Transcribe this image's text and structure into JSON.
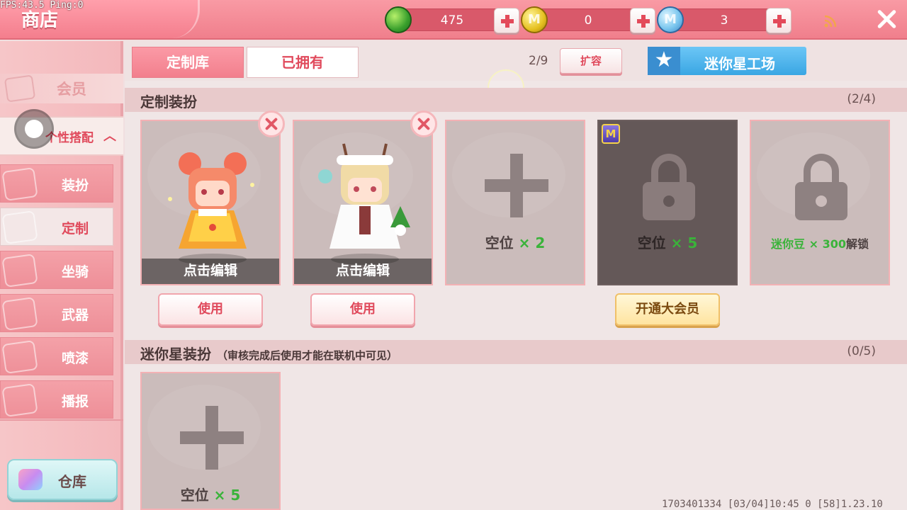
{
  "debug": {
    "fps_text": "FPS:43.5  Ping:0"
  },
  "header": {
    "title": "商店",
    "currencies": [
      {
        "icon": "green-gem-icon",
        "glyph": "",
        "amount": "475",
        "color": "#3aa02d"
      },
      {
        "icon": "gold-coin-icon",
        "glyph": "M",
        "amount": "0",
        "color": "#e5c020"
      },
      {
        "icon": "blue-coin-icon",
        "glyph": "M",
        "amount": "3",
        "color": "#7cc7ef"
      }
    ]
  },
  "sidebar": {
    "member": "会员",
    "group": "个性搭配",
    "items": [
      {
        "label": "装扮",
        "icon": "shirt-icon",
        "active": false
      },
      {
        "label": "定制",
        "icon": "custom-card-icon",
        "active": true
      },
      {
        "label": "坐骑",
        "icon": "mount-icon",
        "active": false
      },
      {
        "label": "武器",
        "icon": "gun-icon",
        "active": false
      },
      {
        "label": "喷漆",
        "icon": "spray-can-icon",
        "active": false
      },
      {
        "label": "播报",
        "icon": "broadcast-icon",
        "active": false
      }
    ],
    "warehouse": "仓库"
  },
  "main": {
    "tabs": {
      "active": "定制库",
      "inactive": "已拥有"
    },
    "capacity": "2/9",
    "expand": "扩容",
    "workshop": "迷你星工场",
    "custom_section": {
      "title": "定制装扮",
      "count": "(2/4)",
      "edit_label": "点击编辑",
      "use_label": "使用",
      "empty_label": "空位",
      "empty_mult_1": "× 2",
      "empty_mult_2": "× 5",
      "unlock_prefix": "迷你豆 × 300",
      "unlock_suffix": "解锁",
      "vip_label": "开通大会员",
      "vip_badge": "M"
    },
    "star_section": {
      "title": "迷你星装扮",
      "note": "（审核完成后使用才能在联机中可见）",
      "count": "(0/5)",
      "empty_label": "空位",
      "empty_mult": "× 5"
    }
  },
  "footer": {
    "info": "1703401334   [03/04]10:45 0   [58]1.23.10"
  },
  "colors": {
    "accent": "#f07f8c",
    "accent_text": "#e04a5c",
    "green_text": "#3ab33a",
    "workshop_blue": "#3aa6e3"
  }
}
